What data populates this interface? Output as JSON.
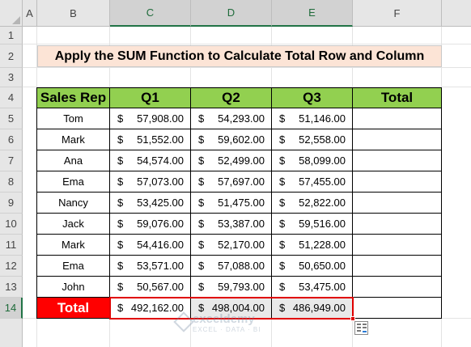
{
  "columns": [
    "A",
    "B",
    "C",
    "D",
    "E",
    "F"
  ],
  "rows": [
    "1",
    "2",
    "3",
    "4",
    "5",
    "6",
    "7",
    "8",
    "9",
    "10",
    "11",
    "12",
    "13",
    "14"
  ],
  "title": "Apply the SUM Function to Calculate Total Row and Column",
  "table": {
    "headers": [
      "Sales Rep",
      "Q1",
      "Q2",
      "Q3",
      "Total"
    ],
    "currency": "$",
    "data": [
      {
        "rep": "Tom",
        "q1": "57,908.00",
        "q2": "54,293.00",
        "q3": "51,146.00"
      },
      {
        "rep": "Mark",
        "q1": "51,552.00",
        "q2": "59,602.00",
        "q3": "52,558.00"
      },
      {
        "rep": "Ana",
        "q1": "54,574.00",
        "q2": "52,499.00",
        "q3": "58,099.00"
      },
      {
        "rep": "Ema",
        "q1": "57,073.00",
        "q2": "57,697.00",
        "q3": "57,455.00"
      },
      {
        "rep": "Nancy",
        "q1": "53,425.00",
        "q2": "51,475.00",
        "q3": "52,822.00"
      },
      {
        "rep": "Jack",
        "q1": "59,076.00",
        "q2": "53,387.00",
        "q3": "59,516.00"
      },
      {
        "rep": "Mark",
        "q1": "54,416.00",
        "q2": "52,170.00",
        "q3": "51,228.00"
      },
      {
        "rep": "Ema",
        "q1": "53,571.00",
        "q2": "57,088.00",
        "q3": "50,650.00"
      },
      {
        "rep": "John",
        "q1": "50,567.00",
        "q2": "59,793.00",
        "q3": "53,475.00"
      }
    ],
    "total_label": "Total",
    "totals": {
      "q1": "492,162.00",
      "q2": "498,004.00",
      "q3": "486,949.00"
    }
  },
  "selection": {
    "columns": [
      "C",
      "D",
      "E"
    ],
    "row": "14"
  },
  "watermark": {
    "name": "exceldemy",
    "sub": "EXCEL · DATA · BI"
  },
  "icons": {
    "quick_analysis": "quick-analysis-icon"
  },
  "colors": {
    "header_fill": "#92d050",
    "total_fill": "#ff0000",
    "title_fill": "#fce4d6",
    "selection": "#e00000"
  }
}
